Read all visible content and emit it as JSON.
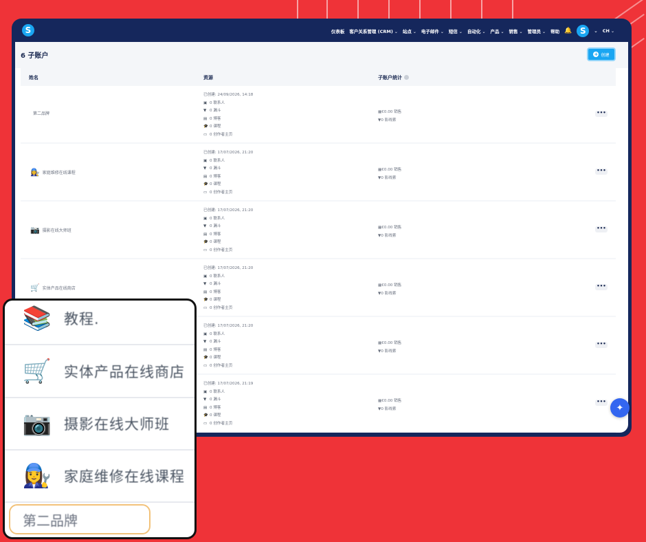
{
  "nav": {
    "items": [
      {
        "label": "仪表板",
        "chevron": false
      },
      {
        "label": "客户关系管理 (CRM)",
        "chevron": true
      },
      {
        "label": "站点",
        "chevron": true
      },
      {
        "label": "电子邮件",
        "chevron": true
      },
      {
        "label": "短信",
        "chevron": true
      },
      {
        "label": "自动化",
        "chevron": true
      },
      {
        "label": "产品",
        "chevron": true
      },
      {
        "label": "销售",
        "chevron": true
      },
      {
        "label": "管理员",
        "chevron": true
      },
      {
        "label": "帮助",
        "chevron": false
      }
    ],
    "logo_letter": "S",
    "avatar_letter": "S",
    "language": "CH"
  },
  "page": {
    "title": "6 子账户",
    "create_label": "创建"
  },
  "table": {
    "headers": {
      "name": "姓名",
      "resources": "资源",
      "stats": "子账户统计"
    },
    "rows": [
      {
        "name": "第二品牌",
        "icon": "",
        "created": "已创建: 24/09/2026, 14:18",
        "contacts": "0 联系人",
        "funnels": "0 漏斗",
        "blogs": "0 博客",
        "courses": "0 课程",
        "creators": "0 创作者主页",
        "sales": "€0.00 销售",
        "leads": "0 影线索"
      },
      {
        "name": "家庭维修在线课程",
        "icon": "👩‍🔧",
        "created": "已创建: 17/07/2026, 21:20",
        "contacts": "0 联系人",
        "funnels": "0 漏斗",
        "blogs": "0 博客",
        "courses": "0 课程",
        "creators": "0 创作者主页",
        "sales": "€0.00 销售",
        "leads": "0 影线索"
      },
      {
        "name": "摄影在线大师班",
        "icon": "📷",
        "created": "已创建: 17/07/2026, 21:20",
        "contacts": "0 联系人",
        "funnels": "0 漏斗",
        "blogs": "0 博客",
        "courses": "0 课程",
        "creators": "0 创作者主页",
        "sales": "€0.00 销售",
        "leads": "0 影线索"
      },
      {
        "name": "实体产品在线商店",
        "icon": "🛒",
        "created": "已创建: 17/07/2026, 21:20",
        "contacts": "0 联系人",
        "funnels": "0 漏斗",
        "blogs": "0 博客",
        "courses": "0 课程",
        "creators": "0 创作者主页",
        "sales": "€0.00 销售",
        "leads": "0 影线索"
      },
      {
        "name": "",
        "icon": "",
        "created": "已创建: 17/07/2026, 21:20",
        "contacts": "0 联系人",
        "funnels": "0 漏斗",
        "blogs": "0 博客",
        "courses": "0 课程",
        "creators": "0 创作者主页",
        "sales": "€0.00 销售",
        "leads": "0 影线索"
      },
      {
        "name": "",
        "icon": "",
        "created": "已创建: 17/07/2026, 21:19",
        "contacts": "0 联系人",
        "funnels": "0 漏斗",
        "blogs": "0 博客",
        "courses": "0 课程",
        "creators": "0 创作者主页",
        "sales": "€0.00 销售",
        "leads": "0 影线索"
      }
    ],
    "more_label": "•••"
  },
  "zoom": {
    "items": [
      {
        "label": "教程.",
        "icon": "📚"
      },
      {
        "label": "实体产品在线商店",
        "icon": "🛒"
      },
      {
        "label": "摄影在线大师班",
        "icon": "📷"
      },
      {
        "label": "家庭维修在线课程",
        "icon": "👩‍🔧"
      }
    ],
    "highlighted": "第二品牌"
  },
  "colors": {
    "background": "#ef3338",
    "frame": "#15275c",
    "accent": "#1aa6f2",
    "highlight": "#f2c27a"
  }
}
